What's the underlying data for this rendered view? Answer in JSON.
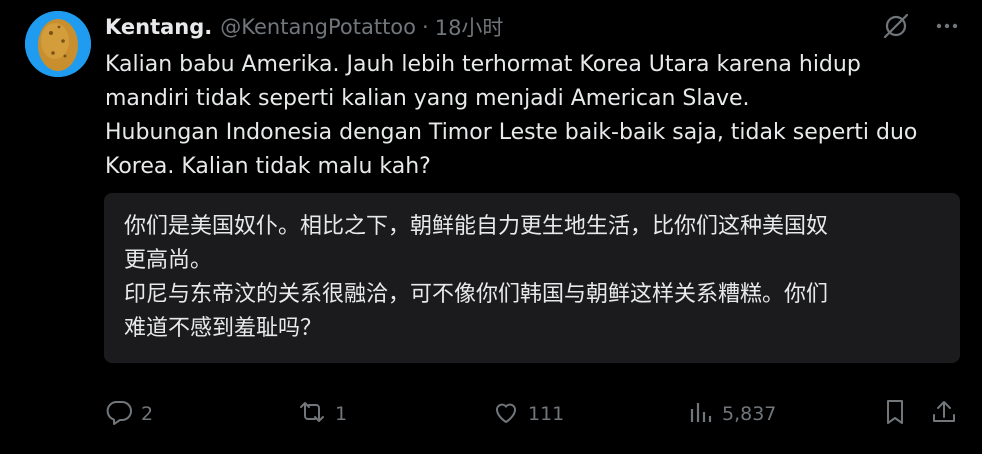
{
  "author": {
    "display_name": "Kentang.",
    "handle": "@KentangPotattoo",
    "separator": "·",
    "time": "18小时"
  },
  "tweet": {
    "lines": [
      "Kalian babu Amerika. Jauh lebih terhormat Korea Utara karena hidup",
      "mandiri tidak seperti kalian yang menjadi American Slave.",
      "Hubungan Indonesia dengan Timor Leste baik-baik saja, tidak seperti duo",
      "Korea. Kalian tidak malu kah?"
    ]
  },
  "translation": {
    "lines": [
      "你们是美国奴仆。相比之下，朝鲜能自力更生地生活，比你们这种美国奴",
      "更高尚。",
      "印尼与东帝汶的关系很融洽，可不像你们韩国与朝鲜这样关系糟糕。你们",
      "难道不感到羞耻吗？"
    ]
  },
  "actions": {
    "replies": "2",
    "reposts": "1",
    "likes": "111",
    "views": "5,837"
  },
  "icons": {
    "top": [
      "grok-icon",
      "more-icon"
    ],
    "bottom": [
      "reply-icon",
      "repost-icon",
      "like-icon",
      "views-icon",
      "bookmark-icon",
      "share-icon"
    ]
  },
  "colors": {
    "background": "#000000",
    "text": "#e7e9ea",
    "secondary": "#71767b",
    "translation_bg": "#1b1b1d",
    "avatar_bg": "#1f9bf0"
  }
}
